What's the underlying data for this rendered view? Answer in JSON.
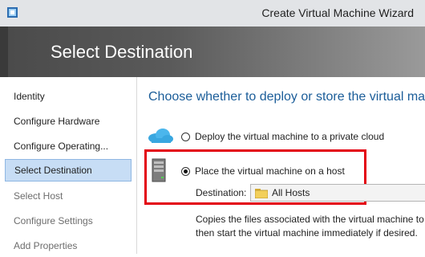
{
  "window": {
    "title": "Create Virtual Machine Wizard",
    "icon": "wizard-icon"
  },
  "header": {
    "title": "Select Destination"
  },
  "sidebar": {
    "items": [
      {
        "label": "Identity",
        "state": "normal"
      },
      {
        "label": "Configure Hardware",
        "state": "normal"
      },
      {
        "label": "Configure Operating...",
        "state": "normal"
      },
      {
        "label": "Select Destination",
        "state": "selected"
      },
      {
        "label": "Select Host",
        "state": "disabled"
      },
      {
        "label": "Configure Settings",
        "state": "disabled"
      },
      {
        "label": "Add Properties",
        "state": "disabled"
      }
    ]
  },
  "main": {
    "heading": "Choose whether to deploy or store the virtual ma",
    "options": [
      {
        "label": "Deploy the virtual machine to a private cloud",
        "selected": false,
        "icon": "cloud-icon"
      },
      {
        "label": "Place the virtual machine on a host",
        "selected": true,
        "icon": "server-icon"
      }
    ],
    "destination": {
      "label": "Destination:",
      "value": "All Hosts",
      "icon": "folder-icon"
    },
    "description": [
      "Copies the files associated with the virtual machine to",
      "then start the virtual machine immediately if desired."
    ]
  },
  "colors": {
    "heading": "#1b5d99",
    "highlight": "#e3000f",
    "selected_bg": "#c7ddf5"
  }
}
